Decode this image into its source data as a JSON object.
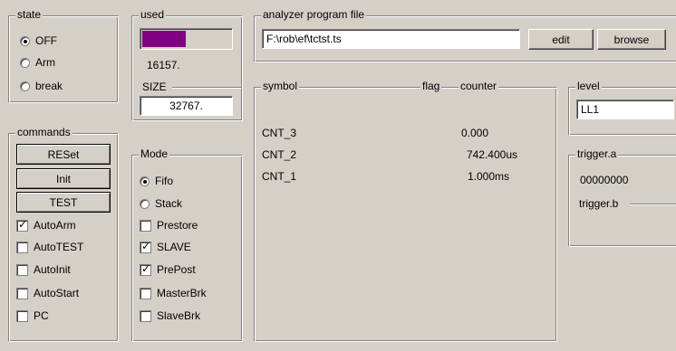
{
  "state": {
    "title": "state",
    "options": [
      {
        "label": "OFF",
        "selected": true
      },
      {
        "label": "Arm",
        "selected": false
      },
      {
        "label": "break",
        "selected": false
      }
    ]
  },
  "used": {
    "title": "used",
    "progress_fraction": 0.4931,
    "value": "16157.",
    "size_title": "SIZE",
    "size_value": "32767."
  },
  "analyzer": {
    "title": "analyzer program file",
    "file": "F:\\rob\\ef\\tctst.ts",
    "edit_label": "edit",
    "browse_label": "browse"
  },
  "symbols": {
    "col_symbol": "symbol",
    "col_flag": "flag",
    "col_counter": "counter",
    "rows": [
      {
        "symbol": "CNT_3",
        "counter": "0.000"
      },
      {
        "symbol": "CNT_2",
        "counter": "742.400us"
      },
      {
        "symbol": "CNT_1",
        "counter": "1.000ms"
      }
    ]
  },
  "level": {
    "title": "level",
    "value": "LL1"
  },
  "trigger": {
    "a_title": "trigger.a",
    "a_value": "00000000",
    "b_title": "trigger.b"
  },
  "commands": {
    "title": "commands",
    "buttons": [
      "RESet",
      "Init",
      "TEST"
    ],
    "checks": [
      {
        "label": "AutoArm",
        "checked": true
      },
      {
        "label": "AutoTEST",
        "checked": false
      },
      {
        "label": "AutoInit",
        "checked": false
      },
      {
        "label": "AutoStart",
        "checked": false
      },
      {
        "label": "PC",
        "checked": false
      }
    ]
  },
  "mode": {
    "title": "Mode",
    "radios": [
      {
        "label": "Fifo",
        "selected": true
      },
      {
        "label": "Stack",
        "selected": false
      }
    ],
    "checks": [
      {
        "label": "Prestore",
        "checked": false
      },
      {
        "label": "SLAVE",
        "checked": true
      },
      {
        "label": "PrePost",
        "checked": true
      },
      {
        "label": "MasterBrk",
        "checked": false
      },
      {
        "label": "SlaveBrk",
        "checked": false
      }
    ]
  }
}
